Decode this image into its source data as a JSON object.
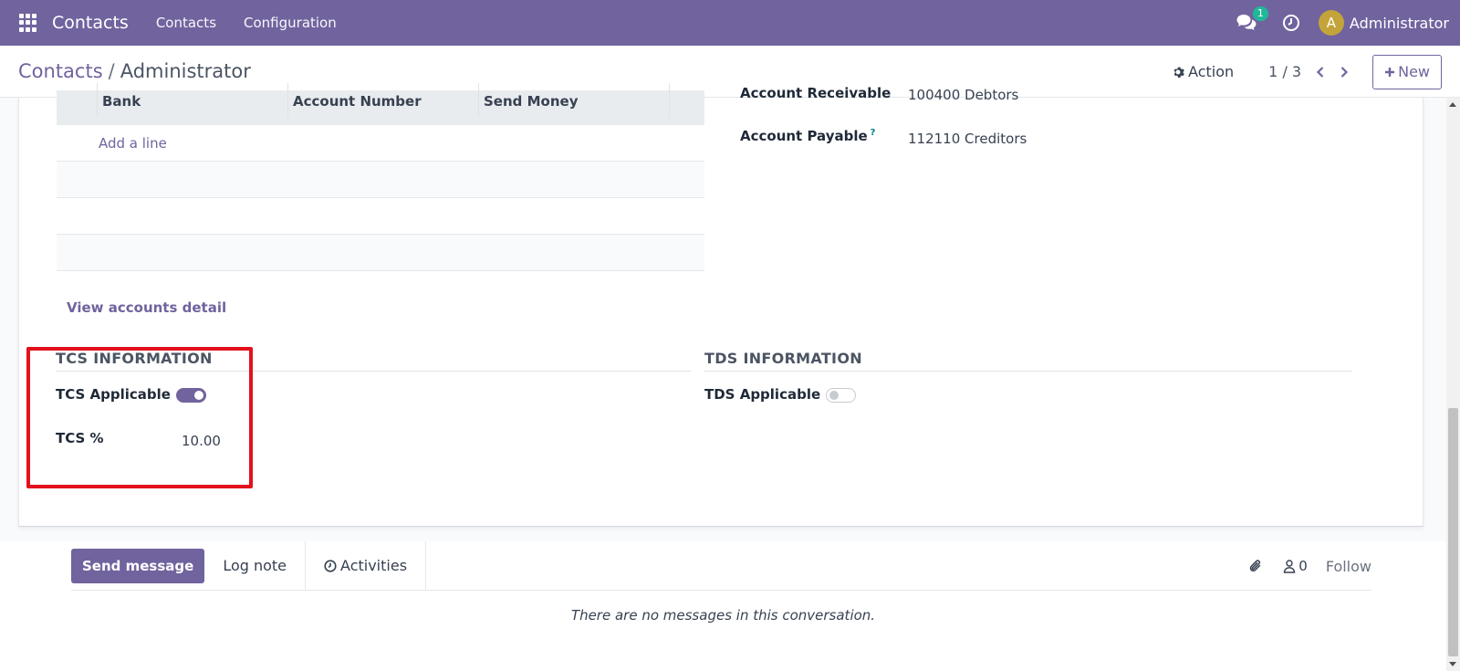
{
  "navbar": {
    "brand": "Contacts",
    "menu": [
      "Contacts",
      "Configuration"
    ],
    "chat_count": "1",
    "avatar_letter": "A",
    "user_name": "Administrator",
    "accent_color": "#71639e"
  },
  "control_panel": {
    "breadcrumb_root": "Contacts",
    "breadcrumb_sep": "/",
    "breadcrumb_current": "Administrator",
    "action_label": "Action",
    "pager": "1 / 3",
    "new_label": "New"
  },
  "bank_table": {
    "columns": [
      "Bank",
      "Account Number",
      "Send Money"
    ],
    "add_line": "Add a line"
  },
  "accounting": {
    "receivable_label": "Account Receivable",
    "receivable_value": "100400 Debtors",
    "payable_label": "Account Payable",
    "payable_help": "?",
    "payable_value": "112110 Creditors"
  },
  "view_accounts_label": "View accounts detail",
  "tcs": {
    "title": "TCS INFORMATION",
    "applicable_label": "TCS Applicable",
    "applicable": true,
    "percent_label": "TCS %",
    "percent_value": "10.00"
  },
  "tds": {
    "title": "TDS INFORMATION",
    "applicable_label": "TDS Applicable",
    "applicable": false
  },
  "chatter": {
    "send_message": "Send message",
    "log_note": "Log note",
    "activities": "Activities",
    "followers_count": "0",
    "follow": "Follow",
    "empty_text": "There are no messages in this conversation."
  },
  "highlight_color": "#e3111b"
}
